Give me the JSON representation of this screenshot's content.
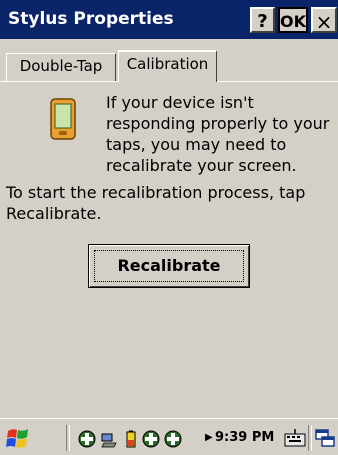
{
  "window": {
    "title": "Stylus Properties",
    "help_label": "?",
    "ok_label": "OK",
    "close_label": "×"
  },
  "tabs": [
    {
      "label": "Double-Tap",
      "selected": false
    },
    {
      "label": "Calibration",
      "selected": true
    }
  ],
  "calibration": {
    "info_text": "If your device isn't responding properly to your taps, you may need to recalibrate your screen.",
    "instruction_text": "To start the recalibration process, tap Recalibrate.",
    "recalibrate_label": "Recalibrate"
  },
  "taskbar": {
    "clock": "9:39 PM",
    "tray_icons": [
      "connection-icon",
      "network-icon",
      "battery-icon",
      "connection-icon",
      "connection-icon"
    ]
  },
  "colors": {
    "titlebar": "#0a246a",
    "face": "#d4d0c8"
  }
}
